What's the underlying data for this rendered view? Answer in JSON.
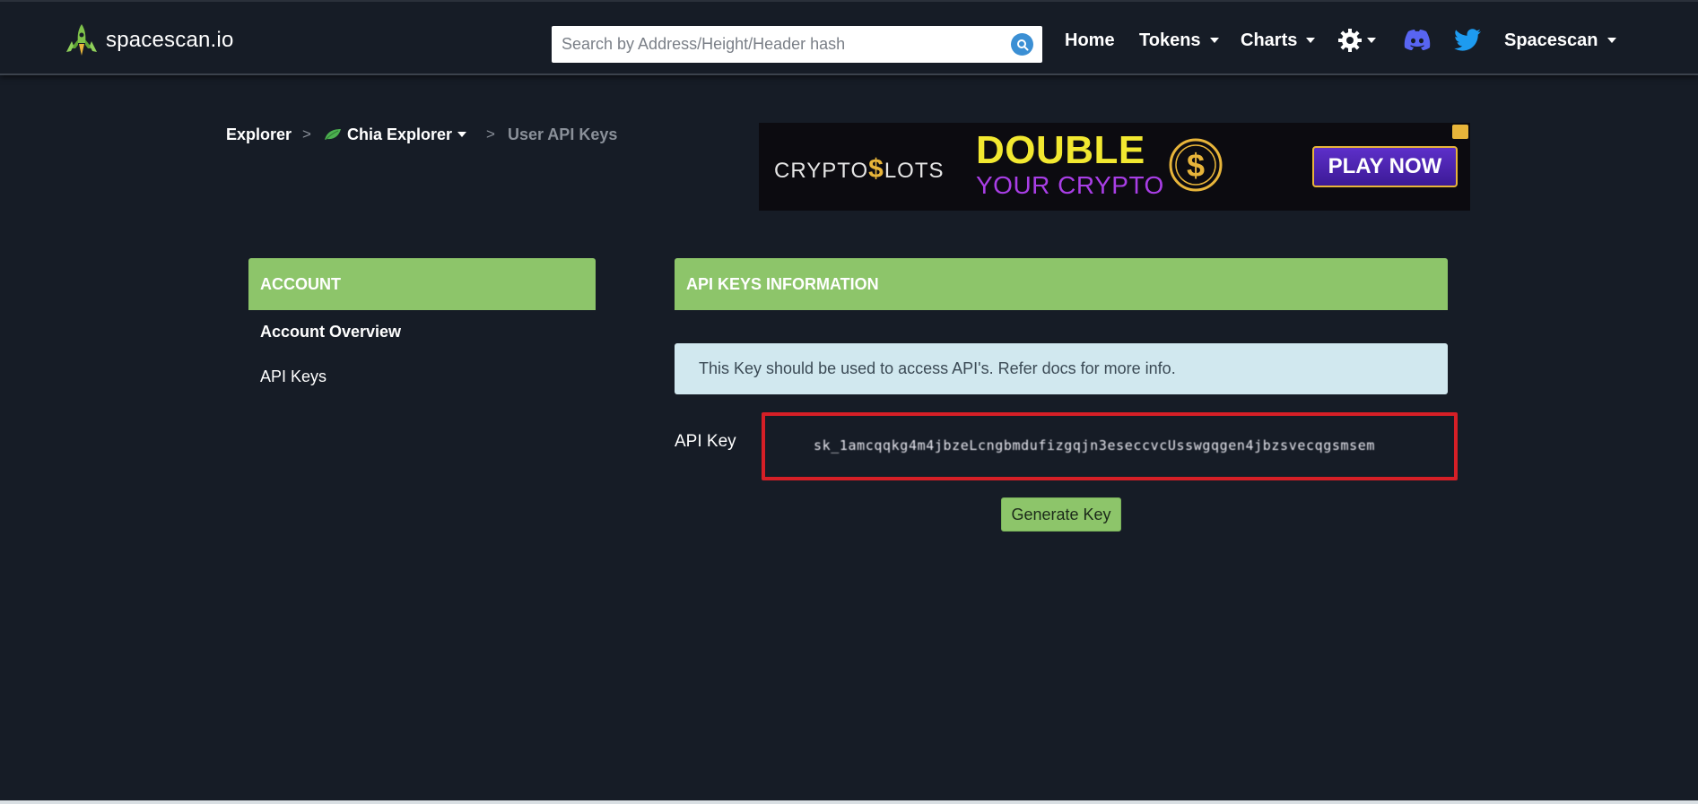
{
  "brand": {
    "name": "spacescan.io"
  },
  "search": {
    "placeholder": "Search by Address/Height/Header hash",
    "value": ""
  },
  "nav": {
    "home": "Home",
    "tokens": "Tokens",
    "charts": "Charts",
    "account_menu": "Spacescan"
  },
  "breadcrumb": {
    "root": "Explorer",
    "sep1": ">",
    "explorer": "Chia Explorer",
    "sep2": ">",
    "current": "User API Keys"
  },
  "ad": {
    "brand_left": "CRYPTO",
    "brand_dollar": "$",
    "brand_right": "LOTS",
    "headline": "DOUBLE",
    "subline": "YOUR CRYPTO",
    "cta": "PLAY NOW"
  },
  "account": {
    "header": "ACCOUNT",
    "items": [
      {
        "label": "Account Overview",
        "active": true
      },
      {
        "label": "API Keys",
        "active": false
      }
    ]
  },
  "api": {
    "header": "API KEYS INFORMATION",
    "info": "This Key should be used to access API's. Refer docs for more info.",
    "key_label": "API Key",
    "key_value": "sk_1amcqqkg4m4jbzeLcngbmdufizgqjn3eseccvcUsswgqgen4jbzsvecqgsmsem",
    "generate_label": "Generate Key"
  },
  "colors": {
    "background": "#161c26",
    "panel_green": "#8dc56a",
    "info_bg": "#d1e8ef",
    "highlight_red": "#d61f26",
    "discord": "#5865f2",
    "twitter": "#1d9bf0"
  },
  "icons": {
    "logo": "rocket-icon",
    "search": "search-icon",
    "settings": "gear-icon",
    "discord": "discord-icon",
    "twitter": "twitter-icon",
    "chia": "leaf-icon"
  }
}
